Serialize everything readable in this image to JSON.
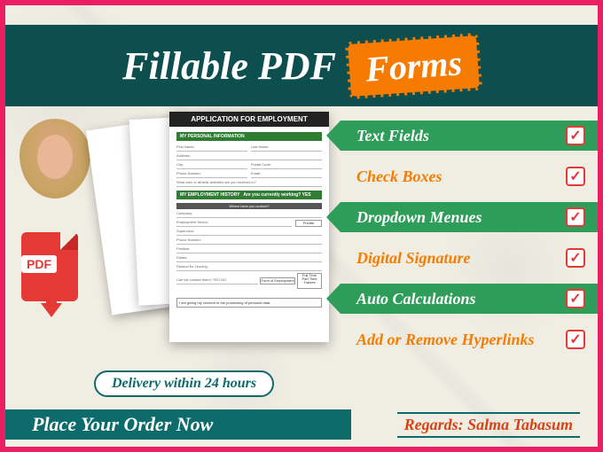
{
  "title": {
    "prefix": "Fillable PDF",
    "badge": "Forms"
  },
  "pdf_icon_label": "PDF",
  "sample_form": {
    "header": "APPLICATION FOR EMPLOYMENT",
    "section1": "MY PERSONAL INFORMATION",
    "section2": "MY EMPLOYMENT HISTORY",
    "fields": {
      "first_name": "First Name:",
      "last_name": "Last Name:",
      "address": "Address:",
      "city": "City:",
      "postal": "Postal Code:",
      "phone": "Phone Number:",
      "email": "Email:",
      "activities": "What civic or athletic activities are you involved in?",
      "currently_working": "Are you currently working? YES",
      "where_worked": "Where have you worked?",
      "company": "Company:",
      "sector": "Employment Sector:",
      "sector_value": "Private",
      "supervisor": "Supervisor:",
      "phone2": "Phone Number:",
      "position": "Position:",
      "duties": "Duties:",
      "reason": "Reason for Leaving:",
      "contact": "Can we contact them? YES   NO",
      "form_emp": "Form of Employment",
      "emp_types": "Full Time\nPart Time\nTrainee",
      "consent": "I am giving my consent to the processing of personal data."
    }
  },
  "features": [
    {
      "label": "Text Fields",
      "style": "green"
    },
    {
      "label": "Check Boxes",
      "style": "plain"
    },
    {
      "label": "Dropdown Menues",
      "style": "green"
    },
    {
      "label": "Digital Signature",
      "style": "plain"
    },
    {
      "label": "Auto Calculations",
      "style": "green"
    },
    {
      "label": "Add or Remove Hyperlinks",
      "style": "plain"
    }
  ],
  "delivery": "Delivery within 24 hours",
  "cta": "Place Your Order Now",
  "regards": "Regards: Salma Tabasum"
}
